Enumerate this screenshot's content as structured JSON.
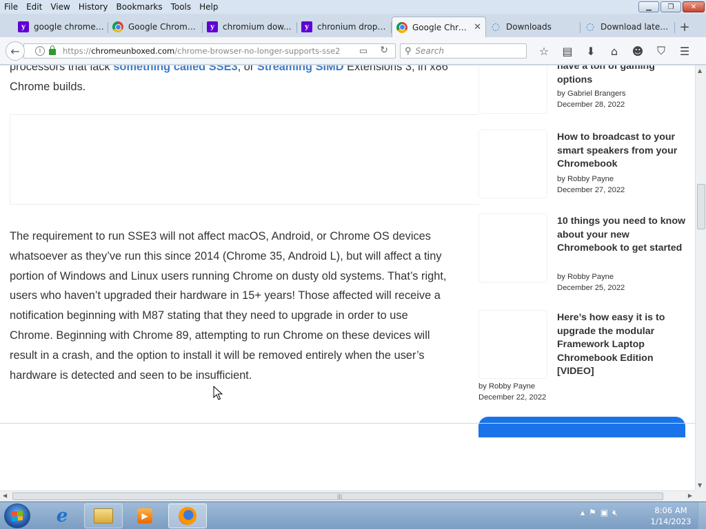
{
  "menubar": {
    "items": [
      "File",
      "Edit",
      "View",
      "History",
      "Bookmarks",
      "Tools",
      "Help"
    ]
  },
  "window_controls": {
    "minimize": "▁",
    "maximize": "❐",
    "close": "✕"
  },
  "tabs": [
    {
      "label": "google chrome ...",
      "icon": "yahoo-icon",
      "active": false
    },
    {
      "label": "Google Chrome ...",
      "icon": "google-icon",
      "active": false
    },
    {
      "label": "chromium dow...",
      "icon": "yahoo-icon",
      "active": false
    },
    {
      "label": "chronium dropp...",
      "icon": "yahoo-icon",
      "active": false
    },
    {
      "label": "Google Chro...",
      "icon": "google-icon",
      "active": true
    },
    {
      "label": "Downloads",
      "icon": "loading-icon",
      "active": false
    },
    {
      "label": "Download latest...",
      "icon": "loading-icon",
      "active": false
    }
  ],
  "navbar": {
    "url_prefix": "https://",
    "url_domain": "chromeunboxed.com",
    "url_path": "/chrome-browser-no-longer-supports-sse2",
    "search_placeholder": "Search"
  },
  "article": {
    "p1_start": "processors that lack ",
    "p1_link1": "something called SSE3",
    "p1_mid": ", or ",
    "p1_link2": "Streaming SIMD",
    "p1_end": " Extensions 3, in x86 Chrome builds.",
    "p2": "The requirement to run SSE3 will not affect macOS, Android, or Chrome OS devices whatsoever as they’ve run this since 2014 (Chrome 35, Android L), but will affect a tiny portion of Windows and Linux users running Chrome on dusty old systems. That’s right, users who haven’t upgraded their hardware in 15+ years! Those affected will receive a notification beginning with M87 stating that they need to upgrade in order to use Chrome. Beginning with Chrome 89, attempting to run Chrome on these devices will result in a crash, and the option to install it will be removed entirely when the user’s hardware is detected and seen to be insufficient."
  },
  "sidebar": {
    "items": [
      {
        "title": "have a ton of gaming options",
        "by": "by",
        "author": "Gabriel Brangers",
        "date": "December 28, 2022"
      },
      {
        "title": "How to broadcast to your smart speakers from your Chromebook",
        "by": "by",
        "author": "Robby Payne",
        "date": "December 27, 2022"
      },
      {
        "title": "10 things you need to know about your new Chromebook to get started",
        "by": "by",
        "author": "Robby Payne",
        "date": "December 25, 2022"
      },
      {
        "title": "Here’s how easy it is to upgrade the modular Framework Laptop Chromebook Edition [VIDEO]",
        "by": "by",
        "author": "Robby Payne",
        "date": "December 22, 2022"
      }
    ]
  },
  "taskbar": {
    "clock_time": "8:06 AM",
    "clock_date": "1/14/2023"
  },
  "colors": {
    "link": "#3d7bc6",
    "taskbar": "#7b9dc2",
    "accent_band": "#1a73e8"
  }
}
